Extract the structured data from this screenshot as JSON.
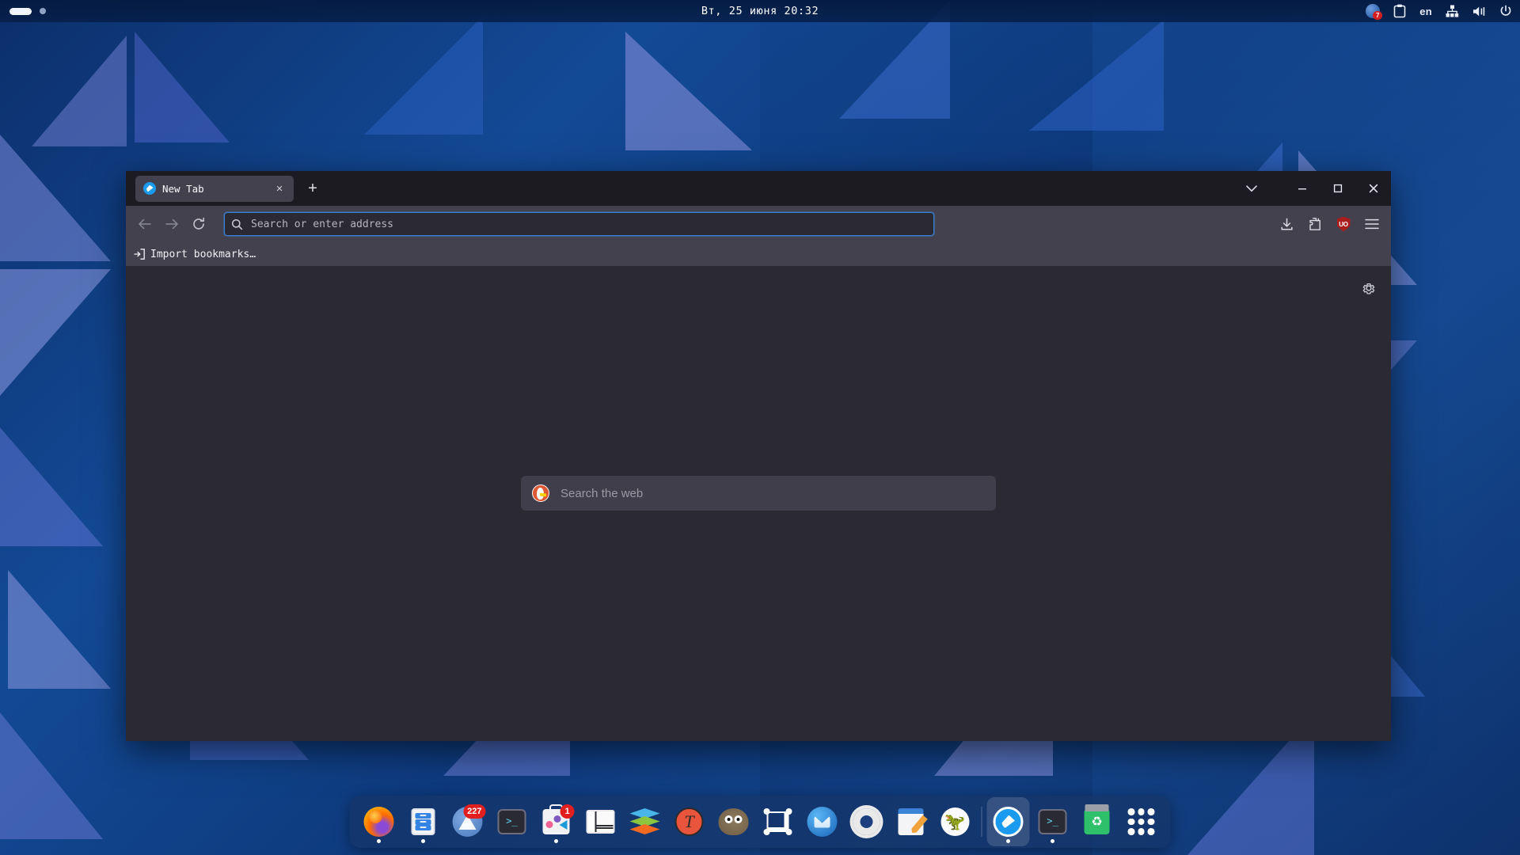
{
  "topbar": {
    "clock": "Вт, 25 июня 20:32",
    "language": "en",
    "notification_badge": "7",
    "tray_icons": [
      "notification-app-icon",
      "clipboard-icon",
      "keyboard-layout",
      "network-icon",
      "volume-icon",
      "power-icon"
    ]
  },
  "browser": {
    "tab": {
      "title": "New Tab",
      "close_label": "×",
      "new_tab_label": "+"
    },
    "window_controls": {
      "tab_list": "∨",
      "minimize": "–",
      "maximize": "□",
      "close": "✕"
    },
    "nav": {
      "back": "←",
      "forward": "→",
      "reload": "⟳",
      "download": "download-icon",
      "extensions": "extensions-icon",
      "ublock_label": "UO",
      "menu": "☰"
    },
    "urlbar": {
      "placeholder": "Search or enter address",
      "value": "",
      "search_icon": "search-icon",
      "accent": "#3a7fd5"
    },
    "bookmarks": {
      "import_label": "Import bookmarks…"
    },
    "newtab": {
      "search_placeholder": "Search the web",
      "search_engine": "DuckDuckGo",
      "settings_icon": "gear-icon",
      "background": "#2b2a33"
    }
  },
  "dock": {
    "items": [
      {
        "name": "firefox",
        "icon": "firefox-icon",
        "badge": "",
        "running": true
      },
      {
        "name": "files",
        "icon": "file-manager-icon",
        "badge": "",
        "running": true
      },
      {
        "name": "messenger",
        "icon": "tent-app-icon",
        "badge": "227",
        "running": false
      },
      {
        "name": "terminal-1",
        "icon": "terminal-icon",
        "badge": "",
        "running": false
      },
      {
        "name": "software-center",
        "icon": "software-store-icon",
        "badge": "1",
        "running": true
      },
      {
        "name": "system-monitor",
        "icon": "system-monitor-icon",
        "badge": "",
        "running": false
      },
      {
        "name": "layers-app",
        "icon": "layers-icon",
        "badge": "",
        "running": false
      },
      {
        "name": "t-app",
        "icon": "telegram-red-icon",
        "badge": "",
        "running": false
      },
      {
        "name": "gimp",
        "icon": "gimp-icon",
        "badge": "",
        "running": false
      },
      {
        "name": "virtualbox",
        "icon": "wireframe-box-icon",
        "badge": "",
        "running": false
      },
      {
        "name": "thunderbird",
        "icon": "thunderbird-icon",
        "badge": "",
        "running": false
      },
      {
        "name": "settings",
        "icon": "gear-icon",
        "badge": "",
        "running": false
      },
      {
        "name": "text-editor",
        "icon": "notes-icon",
        "badge": "",
        "running": false
      },
      {
        "name": "coral-app",
        "icon": "coral-icon",
        "badge": "",
        "running": false
      },
      {
        "name": "web-browser",
        "icon": "compass-browser-icon",
        "badge": "",
        "running": true,
        "active": true
      },
      {
        "name": "terminal-2",
        "icon": "terminal-icon",
        "badge": "",
        "running": true
      },
      {
        "name": "trash",
        "icon": "trash-icon",
        "badge": "",
        "running": false
      },
      {
        "name": "app-grid",
        "icon": "grid-icon",
        "badge": "",
        "running": false
      }
    ]
  }
}
